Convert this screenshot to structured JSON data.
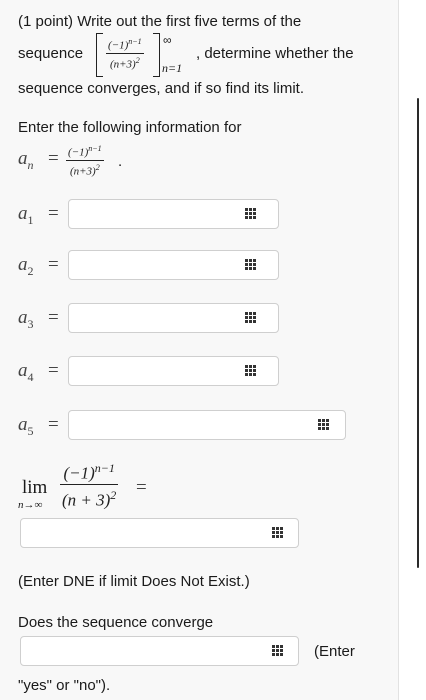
{
  "problem": {
    "points": "(1 point)",
    "line1": "Write out the first five terms of the",
    "seq_word": "sequence",
    "line1b": ", determine whether the",
    "line2": "sequence converges, and if so find its limit.",
    "seq_num": "(−1)",
    "seq_num_exp": "n−1",
    "seq_den": "(n+3)",
    "seq_den_exp": "2",
    "seq_upper": "∞",
    "seq_lower": "n=1"
  },
  "instructions": {
    "line": "Enter the following information for",
    "an_label": "a",
    "an_sub": "n",
    "eq": "=",
    "formula_num": "(−1)",
    "formula_num_exp": "n−1",
    "formula_den": "(n+3)",
    "formula_den_exp": "2",
    "period": "."
  },
  "terms": [
    {
      "label": "a",
      "sub": "1",
      "eq": "=",
      "value": ""
    },
    {
      "label": "a",
      "sub": "2",
      "eq": "=",
      "value": ""
    },
    {
      "label": "a",
      "sub": "3",
      "eq": "=",
      "value": ""
    },
    {
      "label": "a",
      "sub": "4",
      "eq": "=",
      "value": ""
    },
    {
      "label": "a",
      "sub": "5",
      "eq": "=",
      "value": ""
    }
  ],
  "limit": {
    "lim": "lim",
    "lim_sub": "n→∞",
    "num": "(−1)",
    "num_exp": "n−1",
    "den": "(n + 3)",
    "den_exp": "2",
    "eq": "=",
    "value": "",
    "note": "(Enter DNE if limit Does Not Exist.)"
  },
  "converge": {
    "question": "Does the sequence converge",
    "value": "",
    "hint_a": "(Enter",
    "hint_b": "\"yes\" or \"no\")."
  },
  "icons": {
    "palette": "grid-palette-icon"
  }
}
